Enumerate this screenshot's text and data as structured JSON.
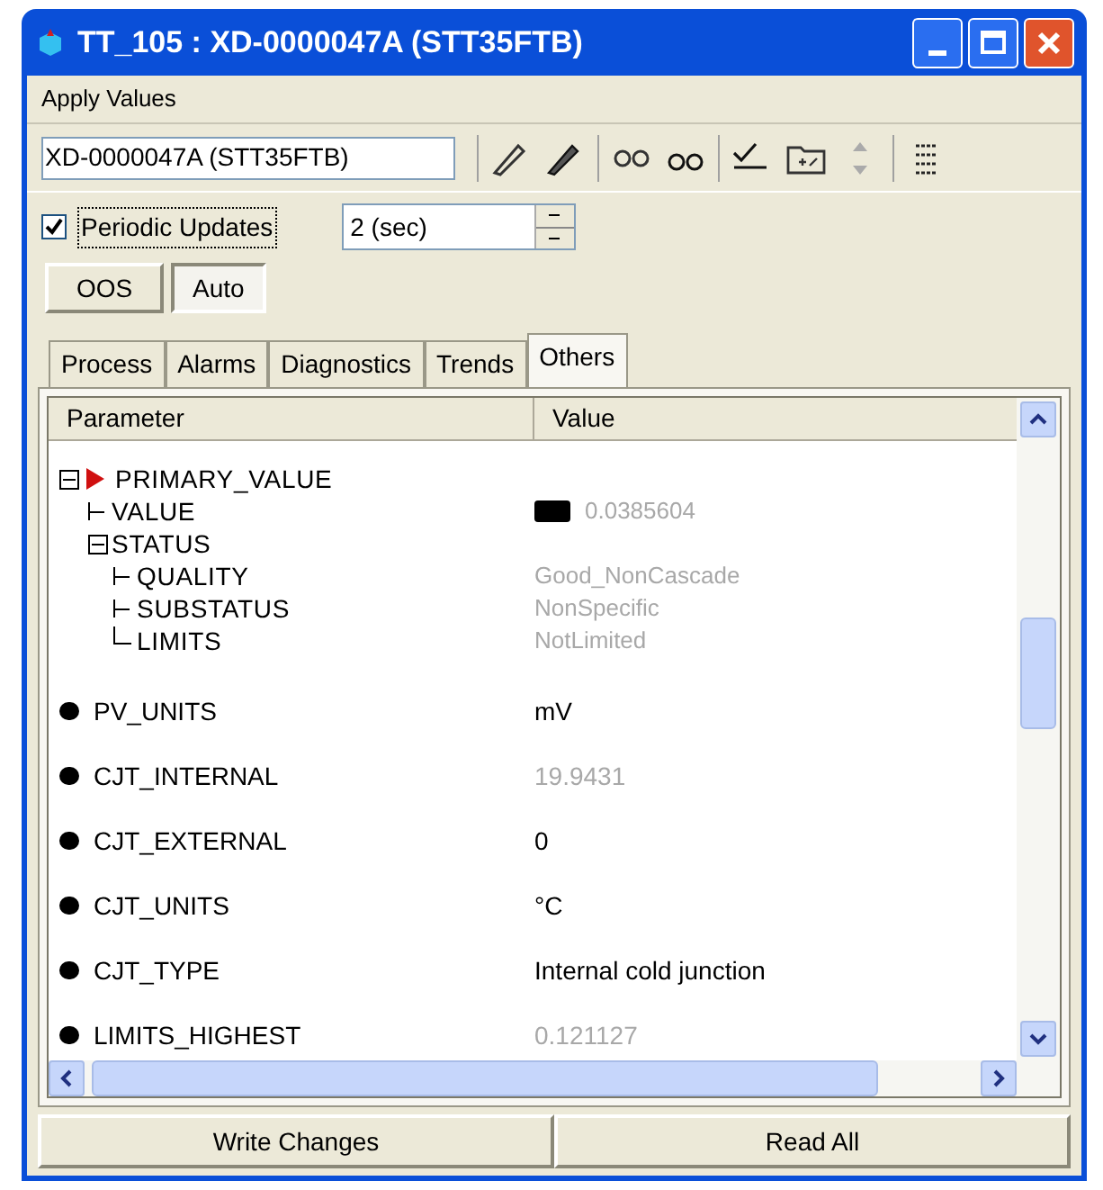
{
  "window": {
    "title": "TT_105 : XD-0000047A (STT35FTB)"
  },
  "menu": [
    "Apply Values"
  ],
  "toolbar": {
    "device_field": "XD-0000047A (STT35FTB)"
  },
  "periodic_updates": {
    "label": "Periodic Updates",
    "checked": true,
    "interval": "2 (sec)"
  },
  "mode_buttons": [
    {
      "label": "OOS",
      "selected": false
    },
    {
      "label": "Auto",
      "selected": true
    }
  ],
  "tabs": [
    {
      "label": "Process",
      "selected": false
    },
    {
      "label": "Alarms",
      "selected": false
    },
    {
      "label": "Diagnostics",
      "selected": false
    },
    {
      "label": "Trends",
      "selected": false
    },
    {
      "label": "Others",
      "selected": true
    }
  ],
  "table": {
    "columns": [
      "Parameter",
      "Value"
    ],
    "rows": [
      {
        "kind": "group",
        "name": "PRIMARY_VALUE",
        "expanded": true,
        "children": [
          {
            "name": "VALUE",
            "value": "0.0385604",
            "dimmed": true
          },
          {
            "name": "STATUS",
            "expanded": true,
            "children": [
              {
                "name": "QUALITY",
                "value": "Good_NonCascade",
                "dimmed": true
              },
              {
                "name": "SUBSTATUS",
                "value": "NonSpecific",
                "dimmed": true
              },
              {
                "name": "LIMITS",
                "value": "NotLimited",
                "dimmed": true
              }
            ]
          }
        ]
      },
      {
        "kind": "item",
        "name": "PV_UNITS",
        "value": "mV",
        "dimmed": false
      },
      {
        "kind": "item",
        "name": "CJT_INTERNAL",
        "value": "19.9431",
        "dimmed": true
      },
      {
        "kind": "item",
        "name": "CJT_EXTERNAL",
        "value": "0",
        "dimmed": false
      },
      {
        "kind": "item",
        "name": "CJT_UNITS",
        "value": "°C",
        "dimmed": false
      },
      {
        "kind": "item",
        "name": "CJT_TYPE",
        "value": "Internal cold junction",
        "dimmed": false
      },
      {
        "kind": "item",
        "name": "LIMITS_HIGHEST",
        "value": "0.121127",
        "dimmed": true
      }
    ]
  },
  "footer_buttons": [
    "Write Changes",
    "Read All"
  ]
}
